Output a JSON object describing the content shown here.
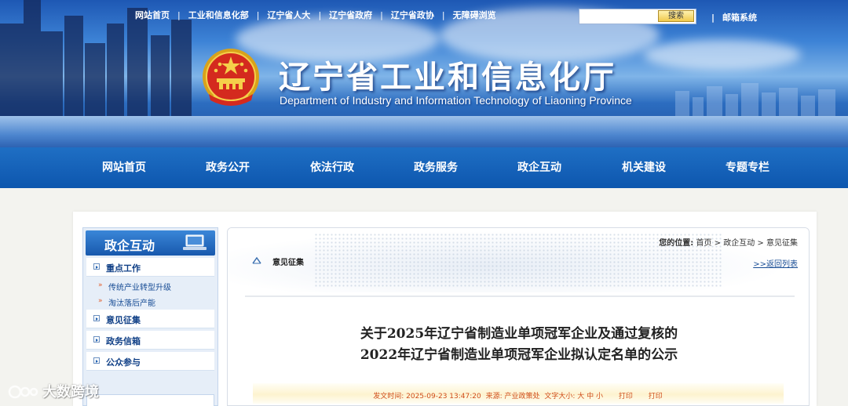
{
  "header": {
    "top_links": [
      "网站首页",
      "工业和信息化部",
      "辽宁省人大",
      "辽宁省政府",
      "辽宁省政协",
      "无障碍浏览"
    ],
    "search_placeholder": "",
    "search_button": "搜索",
    "mail_link": "邮箱系统",
    "site_title": "辽宁省工业和信息化厅",
    "site_subtitle": "Department of Industry and Information Technology of Liaoning Province"
  },
  "nav": {
    "items": [
      "网站首页",
      "政务公开",
      "依法行政",
      "政务服务",
      "政企互动",
      "机关建设",
      "专题专栏"
    ]
  },
  "sidebar": {
    "title": "政企互动",
    "items": [
      {
        "label": "重点工作",
        "sub": [
          "传统产业转型升级",
          "淘汰落后产能"
        ]
      },
      {
        "label": "意见征集",
        "sub": []
      },
      {
        "label": "政务信箱",
        "sub": []
      },
      {
        "label": "公众参与",
        "sub": []
      }
    ]
  },
  "breadcrumb": {
    "label": "您的位置:",
    "path": [
      "首页",
      "政企互动",
      "意见征集"
    ],
    "separator": ">"
  },
  "column": {
    "title": "意见征集",
    "back_link": ">>返回列表"
  },
  "article": {
    "title_line1": "关于2025年辽宁省制造业单项冠军企业及通过复核的",
    "title_line2": "2022年辽宁省制造业单项冠军企业拟认定名单的公示",
    "meta_date": "发文时间: 2025-09-23 13:47:20",
    "meta_source": "来源: 产业政策处",
    "meta_font": "文字大小: 大 中 小",
    "meta_print": "打印",
    "meta_close": "打印"
  },
  "watermark": {
    "text": "大数跨境"
  },
  "colors": {
    "nav_blue": "#0d56ae",
    "link_blue": "#1a4e96",
    "meta_orange": "#d04e1c"
  }
}
